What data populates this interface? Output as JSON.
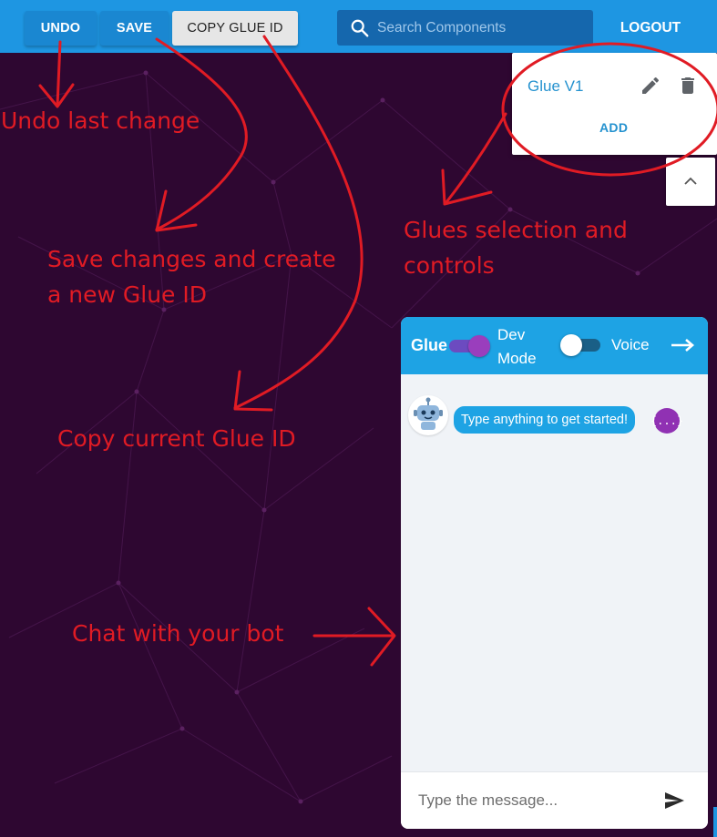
{
  "toolbar": {
    "undo_label": "UNDO",
    "save_label": "SAVE",
    "copy_label": "COPY GLUE ID",
    "search_placeholder": "Search Components",
    "logout_label": "LOGOUT"
  },
  "glues_panel": {
    "glue_name": "Glue V1",
    "add_label": "ADD"
  },
  "chat": {
    "title": "Glue",
    "dev_mode_label": "Dev Mode",
    "dev_mode_on": true,
    "voice_label": "Voice",
    "voice_on": false,
    "bot_message": "Type anything to get started!",
    "json_badge": "{...}",
    "input_placeholder": "Type the message..."
  },
  "annotations": {
    "undo": "Undo last change",
    "save_line1": "Save changes and create",
    "save_line2": "a new Glue ID",
    "glues_line1": "Glues selection and",
    "glues_line2": "controls",
    "copy": "Copy current Glue ID",
    "chat": "Chat with your bot"
  },
  "colors": {
    "background": "#2e0731",
    "toolbar": "#1e96e2",
    "chat_header": "#1ea3e4",
    "annotation": "#e01b24",
    "json_badge": "#9031b3"
  },
  "icons": [
    "search-icon",
    "edit-icon",
    "delete-icon",
    "chevron-up-icon",
    "robot-icon",
    "arrow-right-icon",
    "send-icon"
  ]
}
